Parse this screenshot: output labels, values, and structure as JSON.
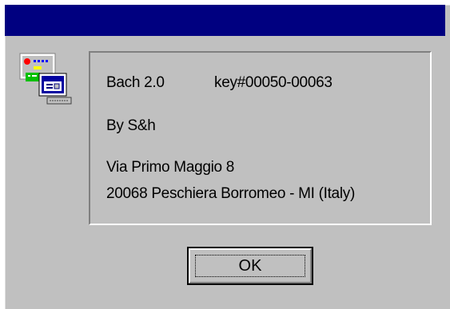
{
  "dialog": {
    "title": "",
    "icon": "computer-network-icon",
    "colors": {
      "face": "#c0c0c0",
      "titlebar": "#000080"
    },
    "info": {
      "product": "Bach 2.0",
      "key": "key#00050-00063",
      "author": "By S&h",
      "address_line1": "Via Primo Maggio 8",
      "address_line2": "20068 Peschiera Borromeo - MI (Italy)"
    },
    "ok_label": "OK"
  }
}
